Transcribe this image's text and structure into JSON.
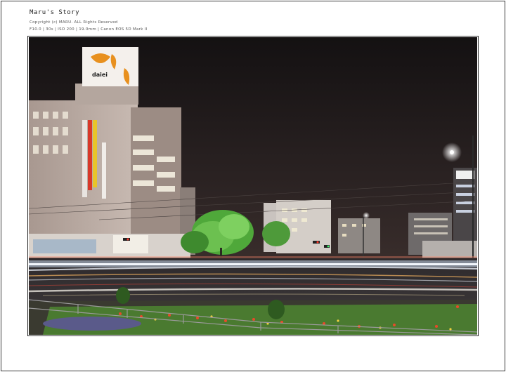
{
  "header": {
    "title": "Maru's Story",
    "copyright": "Copyright (c) MARU. ALL Rights Reserved",
    "exif": "F10.0 | 30s | ISO 200 | 19.0mm | Canon EOS 5D Mark II"
  },
  "photo": {
    "sign_text": "daiei",
    "colors": {
      "sky": "#1c1818",
      "building": "#b8aaa2",
      "tree": "#4fa83a",
      "light_trail": "#e8eef6",
      "sign_orange": "#e8901e"
    }
  }
}
